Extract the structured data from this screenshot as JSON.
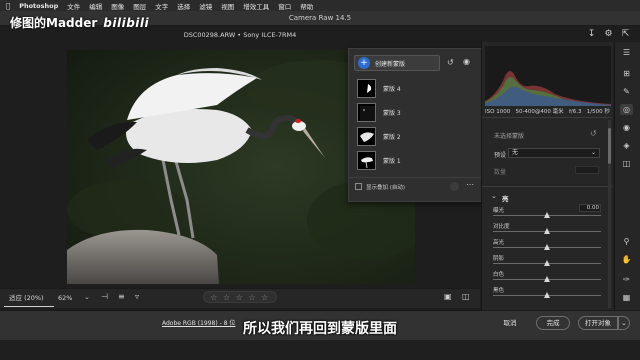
{
  "menubar": {
    "app_name": "Photoshop",
    "items": [
      "文件",
      "编辑",
      "图像",
      "图层",
      "文字",
      "选择",
      "滤镜",
      "视图",
      "增效工具",
      "窗口",
      "帮助"
    ]
  },
  "window": {
    "title": "Camera Raw 14.5"
  },
  "watermark": {
    "text": "修图的Madder",
    "logo_text": "bilibili"
  },
  "file_info": "DSC00298.ARW  •  Sony ILCE-7RM4",
  "mask_panel": {
    "create_label": "创建新蒙版",
    "masks": [
      {
        "label": "蒙版 4"
      },
      {
        "label": "蒙版 3"
      },
      {
        "label": "蒙版 2"
      },
      {
        "label": "蒙版 1"
      }
    ],
    "overlay_label": "显示叠加 (自动)"
  },
  "exif": {
    "iso": "ISO 1000",
    "focal": "50-400@400 毫米",
    "aperture": "f/6.3",
    "shutter": "1/500 秒"
  },
  "right_panel": {
    "selected_mask_label": "未选择蒙版",
    "preset_label": "预设",
    "preset_value": "无",
    "amount_label": "数量",
    "section_title": "亮",
    "sliders": [
      {
        "label": "曝光",
        "value": "0.00",
        "level": 0.5
      },
      {
        "label": "对比度",
        "value": "0",
        "level": 0.5
      },
      {
        "label": "高光",
        "value": "0",
        "level": 0.5
      },
      {
        "label": "阴影",
        "value": "0",
        "level": 0.5
      },
      {
        "label": "白色",
        "value": "0",
        "level": 0.5
      },
      {
        "label": "黑色",
        "value": "0",
        "level": 0.5
      }
    ]
  },
  "bottom_toolbar": {
    "fit_label": "适应 (20%)",
    "zoom_label": "62%",
    "stars": "☆ ☆ ☆ ☆ ☆"
  },
  "footer": {
    "workflow_text": "Adobe RGB (1998) - 8 位",
    "subtitle": "所以我们再回到蒙版里面",
    "cancel_label": "取消",
    "done_label": "完成",
    "open_label": "打开对象"
  },
  "colors": {
    "accent": "#2d6dcf",
    "panel": "#262626",
    "crane_red": "#d0201f"
  }
}
